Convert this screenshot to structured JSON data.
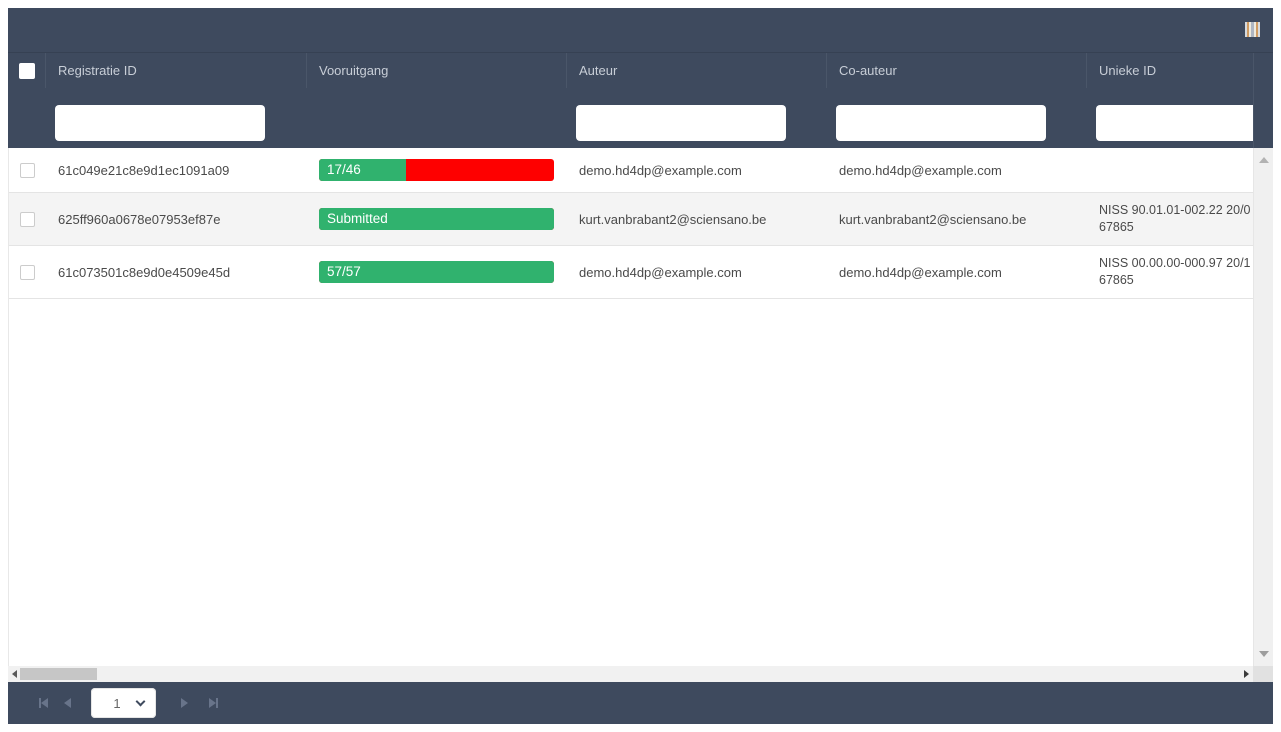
{
  "grid": {
    "toolbar": {
      "icon": "columns-icon"
    },
    "header": {
      "columns": [
        {
          "label": "Registratie ID"
        },
        {
          "label": "Vooruitgang"
        },
        {
          "label": "Auteur"
        },
        {
          "label": "Co-auteur"
        },
        {
          "label": "Unieke ID"
        }
      ]
    },
    "filters": {
      "registratie_id": {
        "value": "",
        "placeholder": ""
      },
      "auteur": {
        "value": "",
        "placeholder": ""
      },
      "co_auteur": {
        "value": "",
        "placeholder": ""
      },
      "unieke_id": {
        "value": "",
        "placeholder": ""
      }
    },
    "rows": [
      {
        "registratie_id": "61c049e21c8e9d1ec1091a09",
        "progress": {
          "label": "17/46",
          "percent": 37
        },
        "auteur": "demo.hd4dp@example.com",
        "co_auteur": "demo.hd4dp@example.com",
        "unieke_id_line1": "",
        "unieke_id_line2": ""
      },
      {
        "registratie_id": "625ff960a0678e07953ef87e",
        "progress": {
          "label": "Submitted",
          "percent": 100
        },
        "auteur": "kurt.vanbrabant2@sciensano.be",
        "co_auteur": "kurt.vanbrabant2@sciensano.be",
        "unieke_id_line1": "NISS 90.01.01-002.22 20/0",
        "unieke_id_line2": "67865"
      },
      {
        "registratie_id": "61c073501c8e9d0e4509e45d",
        "progress": {
          "label": "57/57",
          "percent": 100
        },
        "auteur": "demo.hd4dp@example.com",
        "co_auteur": "demo.hd4dp@example.com",
        "unieke_id_line1": "NISS 00.00.00-000.97 20/1",
        "unieke_id_line2": "67865"
      }
    ],
    "pager": {
      "page": "1"
    }
  },
  "colors": {
    "header_bg": "#3e4a5e",
    "progress_green": "#30b26e",
    "progress_red": "#fe0000",
    "row_stripe": "#f4f4f4"
  },
  "icons": {
    "toolbar": "columns-icon",
    "pager": [
      "first-page-icon",
      "prev-page-icon",
      "page-select-chevron-down-icon",
      "next-page-icon",
      "last-page-icon"
    ]
  }
}
